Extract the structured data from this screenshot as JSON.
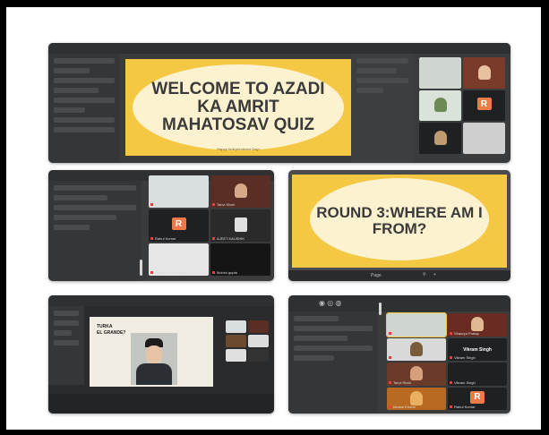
{
  "panel1": {
    "slide_title": "WELCOME TO AZADI KA AMRIT MAHATOSAV  QUIZ",
    "slide_subtitle": "Happy Independence Day!",
    "tile_names": [
      "",
      "",
      "",
      "",
      "",
      ""
    ]
  },
  "panel2": {
    "tile_names": [
      "",
      "Tanvi Shah",
      "Rahul Kumar",
      "AJEET KAUSHIK",
      "Ishaan Vikram Singh",
      "Mohini gupta"
    ]
  },
  "panel3": {
    "slide_title": "ROUND 3:WHERE AM I FROM?",
    "toolbar_page": "Page"
  },
  "panel4": {
    "slide_text_line1": "TURKA",
    "slide_text_line2": "EL GRANDE?"
  },
  "panel5": {
    "tile_names": [
      "",
      "Shaurya Pratap",
      "",
      "Vikram Singh",
      "Tanvi Shah",
      "Vikram Singh",
      "Ishaan Kumar",
      "Rahul Kumar"
    ],
    "big_label": "Vikram Singh"
  },
  "avatar_letter": "R",
  "colors": {
    "slide_yellow": "#f4c842",
    "panel_bg": "#3a3b3d",
    "avatar_orange": "#ee7a4a",
    "frame": "#000000"
  }
}
